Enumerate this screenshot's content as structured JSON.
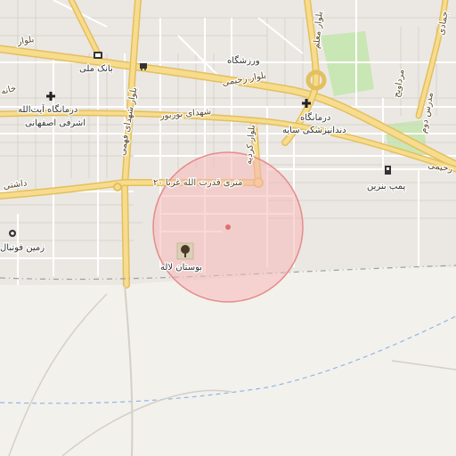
{
  "colors": {
    "land": "#f3f1ec",
    "urban": "#ebe8e3",
    "block_outline": "#d7d3cc",
    "major_road": "#f7dc8d",
    "major_road_casing": "#e3bf5e",
    "minor_road": "#ffffff",
    "park": "#c9e6b5",
    "boundary": "#9aa0a6",
    "waterway": "#8fb6e8",
    "highlight_fill": "#f6b8b8",
    "highlight_stroke": "#e58c8c"
  },
  "roads": {
    "bolvar_rahimi_left": "بلوار رحیمی",
    "bolvar_rahimi_right": "رحیمی",
    "bolvar_malem": "بلوار معلم",
    "bolvar_kordeh": "بلوار کردیه",
    "shahid_bourbour": "شهدای بوربور",
    "shahid_fahmi": "بلوار شهدای فهمی",
    "qodratollah": "۲۰ متری قدرت الله غربا",
    "dashti": "داشتی",
    "mardavij": "مرداویج",
    "madres_dom": "مدرس دوم",
    "jamadi": "جمادی",
    "bolvar_top_left": "بلوار",
    "khaneh": "خانه"
  },
  "pois": {
    "bank_melli": "بانک ملی",
    "varzeshgah": "ورزشگاه",
    "clinic_ayatollah_line1": "درمانگاه آیت‌الله",
    "clinic_ayatollah_line2": "اشرفی اصفهانی",
    "clinic_sayeh_line1": "درمانگاه",
    "clinic_sayeh_line2": "دندانپزشکی سایه",
    "gas_station": "پمپ بنزین",
    "bustan_laleh": "بوستان لاله",
    "zamin_football": "زمین فوتبال"
  },
  "icons": {
    "bank": "atm-icon",
    "shop": "shopping-cart-icon",
    "clinic": "medical-cross-icon",
    "fuel": "fuel-pump-icon",
    "park": "tree-icon",
    "football": "football-icon"
  }
}
